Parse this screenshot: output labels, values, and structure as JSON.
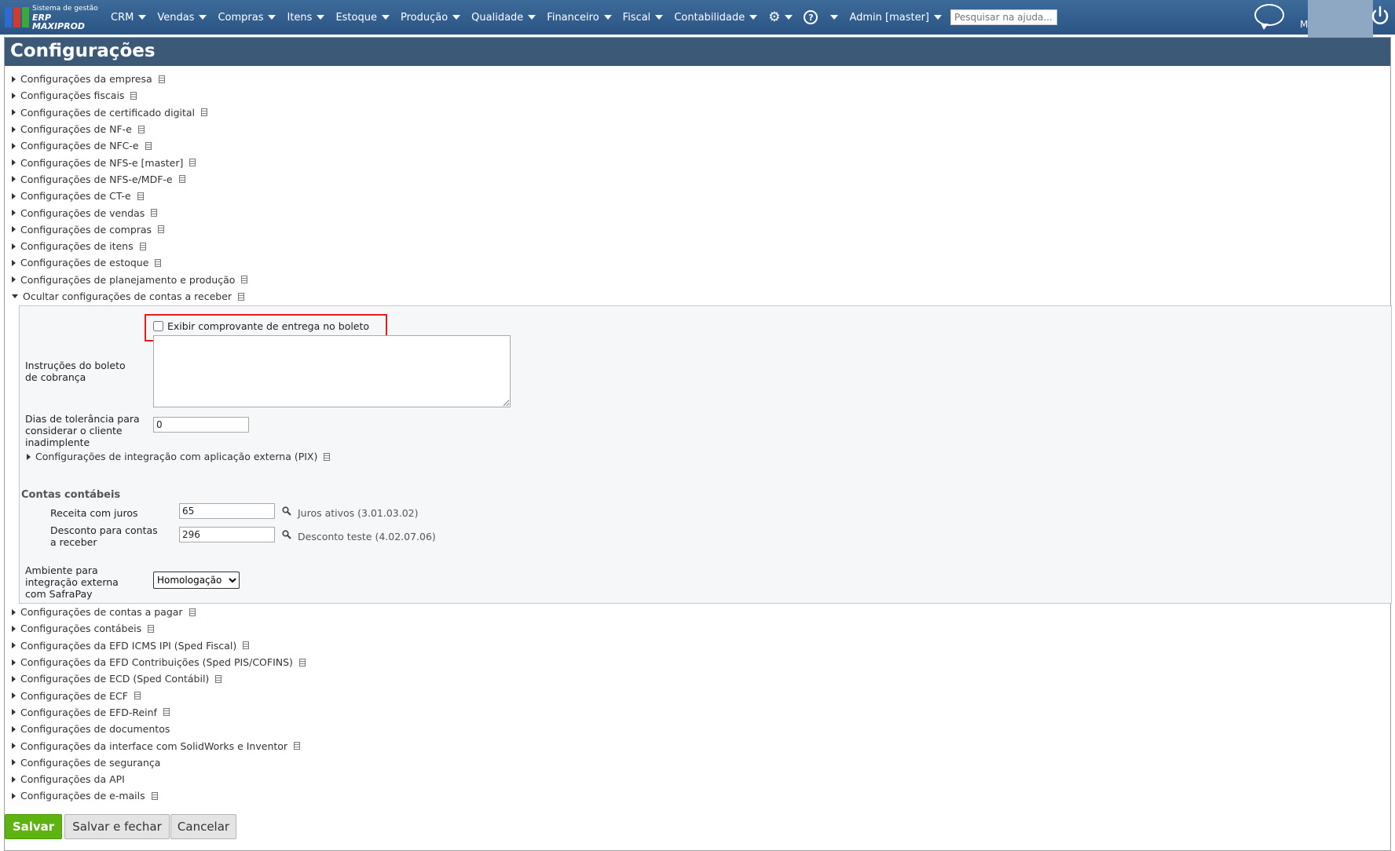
{
  "topbar": {
    "logo_small": "Sistema de gestão",
    "logo_big": "ERP MAXIPROD",
    "menus": [
      "CRM",
      "Vendas",
      "Compras",
      "Itens",
      "Estoque",
      "Produção",
      "Qualidade",
      "Financeiro",
      "Fiscal",
      "Contabilidade"
    ],
    "admin_label": "Admin [master]",
    "search_placeholder": "Pesquisar na ajuda...",
    "user_initial": "M"
  },
  "page": {
    "title": "Configurações"
  },
  "sections_top": [
    "Configurações da empresa",
    "Configurações fiscais",
    "Configurações de certificado digital",
    "Configurações de NF-e",
    "Configurações de NFC-e",
    "Configurações de NFS-e [master]",
    "Configurações de NFS-e/MDF-e",
    "Configurações de CT-e",
    "Configurações de vendas",
    "Configurações de compras",
    "Configurações de itens",
    "Configurações de estoque",
    "Configurações de planejamento e produção"
  ],
  "expanded_section": "Ocultar configurações de contas a receber",
  "receivables": {
    "checkbox_label": "Exibir comprovante de entrega no boleto",
    "instructions_label_1": "Instruções do boleto",
    "instructions_label_2": "de cobrança",
    "instructions_value": "",
    "tolerance_label_1": "Dias de tolerância para",
    "tolerance_label_2": "considerar o cliente",
    "tolerance_label_3": "inadimplente",
    "tolerance_value": "0",
    "pix_section": "Configurações de integração com aplicação externa (PIX)",
    "accounts_title": "Contas contábeis",
    "interest_label": "Receita com juros",
    "interest_value": "65",
    "interest_desc": "Juros ativos (3.01.03.02)",
    "discount_label_1": "Desconto para contas",
    "discount_label_2": "a receber",
    "discount_value": "296",
    "discount_desc": "Desconto teste (4.02.07.06)",
    "env_label_1": "Ambiente para",
    "env_label_2": "integração externa",
    "env_label_3": "com SafraPay",
    "env_selected": "Homologação"
  },
  "sections_bottom": [
    "Configurações de contas a pagar",
    "Configurações contábeis",
    "Configurações da EFD ICMS IPI (Sped Fiscal)",
    "Configurações da EFD Contribuições (Sped PIS/COFINS)",
    "Configurações de ECD (Sped Contábil)",
    "Configurações de ECF",
    "Configurações de EFD-Reinf",
    "Configurações de documentos",
    "Configurações da interface com SolidWorks e Inventor",
    "Configurações de segurança",
    "Configurações da API",
    "Configurações de e-mails"
  ],
  "bottom_sections_without_doc_icon": [
    7,
    9,
    10
  ],
  "buttons": {
    "save": "Salvar",
    "save_close": "Salvar e fechar",
    "cancel": "Cancelar"
  },
  "colors": {
    "topbar": "#2f5b8a",
    "title_bar": "#3c5a78",
    "save_button": "#5db30f",
    "highlight": "#e21b1b"
  }
}
